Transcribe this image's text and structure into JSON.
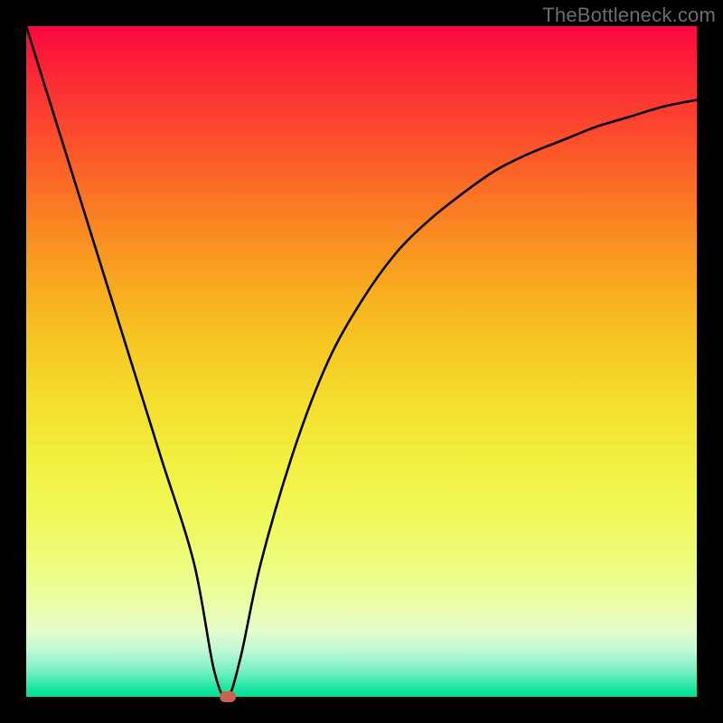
{
  "watermark": "TheBottleneck.com",
  "colors": {
    "frame": "#000000",
    "curve": "#000000",
    "marker": "#cb5f50",
    "gradient_top": "#fb073f",
    "gradient_bottom": "#00e099"
  },
  "chart_data": {
    "type": "line",
    "title": "",
    "xlabel": "",
    "ylabel": "",
    "xlim": [
      0,
      100
    ],
    "ylim": [
      0,
      100
    ],
    "grid": false,
    "series": [
      {
        "name": "curve",
        "x": [
          0,
          5,
          10,
          15,
          20,
          25,
          28,
          30,
          32,
          35,
          40,
          45,
          50,
          55,
          60,
          65,
          70,
          75,
          80,
          85,
          90,
          95,
          100
        ],
        "values": [
          100,
          84,
          68,
          52,
          36,
          20,
          4,
          0,
          6,
          20,
          37,
          50,
          59,
          66,
          71,
          75,
          78.5,
          81,
          83,
          85,
          86.5,
          88,
          89
        ]
      }
    ],
    "marker": {
      "x": 30,
      "y": 0
    },
    "annotations": []
  }
}
